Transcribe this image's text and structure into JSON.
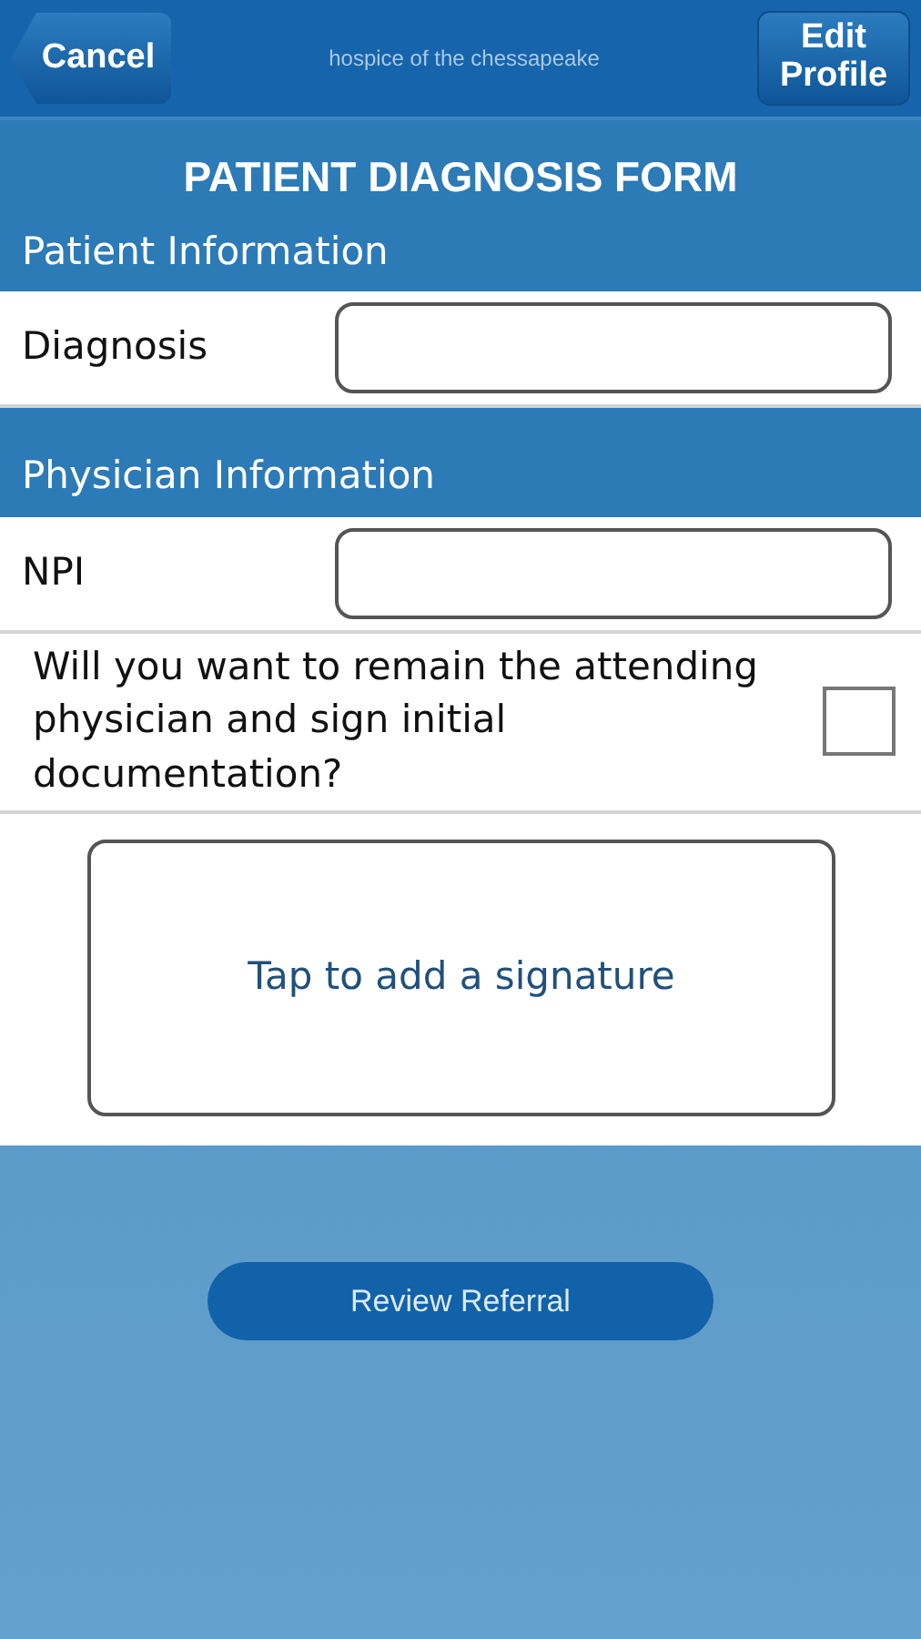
{
  "header": {
    "cancel": "Cancel",
    "title": "hospice of the chessapeake",
    "edit": "Edit Profile"
  },
  "form_title": "PATIENT DIAGNOSIS FORM",
  "sections": [
    {
      "heading": "Patient Information",
      "fields": [
        {
          "kind": "text",
          "label": "Diagnosis"
        }
      ]
    },
    {
      "heading": "Physician Information",
      "fields": [
        {
          "kind": "text",
          "label": "NPI"
        },
        {
          "kind": "checkbox",
          "label": "Will you want to remain the attending physician and sign initial documentation?",
          "checked": false
        }
      ]
    }
  ],
  "signature": {
    "prompt": "Tap to add a signature"
  },
  "review_button": "Review Referral"
}
